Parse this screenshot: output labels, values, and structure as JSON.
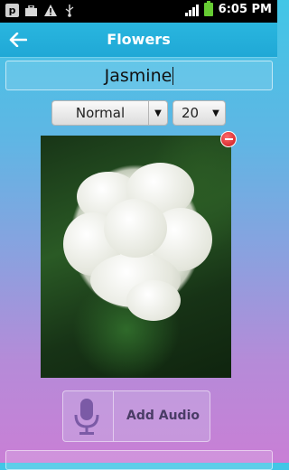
{
  "status_bar": {
    "time": "6:05 PM",
    "notification_icons": [
      "p-app-icon",
      "briefcase-icon",
      "warning-icon",
      "usb-icon"
    ],
    "system_icons": [
      "signal-icon",
      "battery-charging-icon"
    ]
  },
  "action_bar": {
    "title": "Flowers",
    "back_icon": "back-arrow-icon",
    "color": "#29b6df"
  },
  "name_field": {
    "value": "Jasmine"
  },
  "style_select": {
    "value": "Normal"
  },
  "size_select": {
    "value": "20"
  },
  "photo": {
    "subject": "white jasmine flower",
    "remove_icon": "remove-icon"
  },
  "audio_button": {
    "label": "Add Audio",
    "icon": "microphone-icon"
  }
}
